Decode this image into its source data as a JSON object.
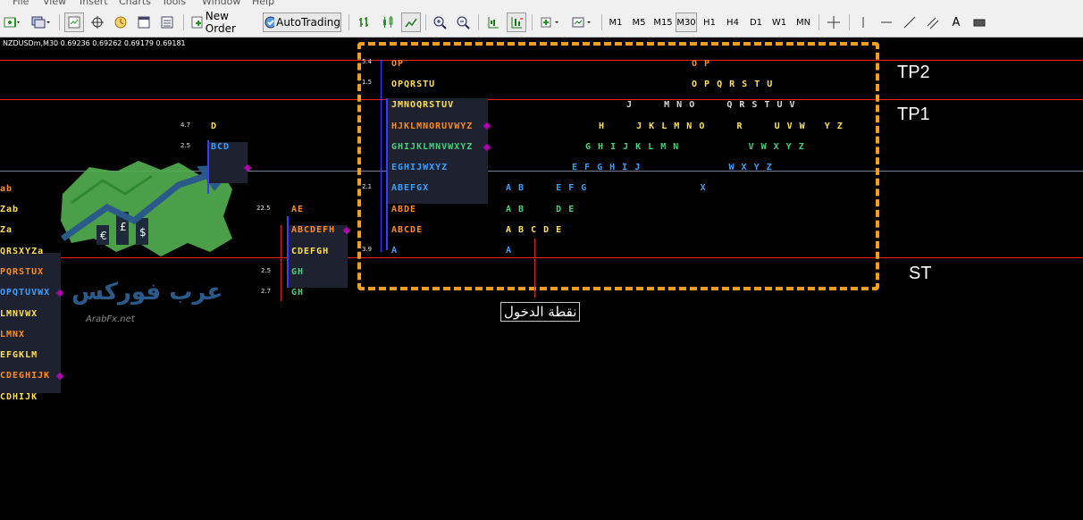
{
  "menu": [
    "File",
    "View",
    "Insert",
    "Charts",
    "Tools",
    "Window",
    "Help"
  ],
  "toolbar": {
    "new_order_label": "New Order",
    "autotrading_label": "AutoTrading",
    "timeframes": [
      "M1",
      "M5",
      "M15",
      "M30",
      "H1",
      "H4",
      "D1",
      "W1",
      "MN"
    ],
    "active_timeframe": "M30",
    "text_tool_label": "A"
  },
  "chart": {
    "symbol_info": "NZDUSDm,M30  0.69236 0.69262 0.69179 0.69181",
    "levels": {
      "tp2": "TP2",
      "tp1": "TP1",
      "st": "ST"
    },
    "entry_label": "نقطة الدخول",
    "logo_text": "عرب فوركس",
    "logo_sub": "ArabFx.net",
    "colors": {
      "level_line": "#ff2020",
      "price_line": "#7a7f9a",
      "box": "#f0a020",
      "profile_bar": "#3b3bff"
    },
    "profile_left": [
      "ab",
      "Zab",
      "Za",
      "QRSXYZa",
      "PQRSTUX",
      "OPQTUVWX",
      "LMNVWX",
      "LMNX",
      "EFGKLM",
      "CDEGHIJK",
      "CDHIJK"
    ],
    "profile_mid_top": {
      "d": "D",
      "bcd": "BCD",
      "val1": "4.7",
      "val2": "2.5"
    },
    "profile_mid": [
      "AE",
      "ABCDEFH",
      "CDEFGH",
      "GH",
      "GH"
    ],
    "profile_mid_vals": [
      "22.5",
      "2.5",
      "2.7"
    ],
    "profile_main": [
      "OP",
      "OPQRSTU",
      "JMNOQRSTUV",
      "HJKLMNORUVWYZ",
      "GHIJKLMNVWXYZ",
      "EGHIJWXYZ",
      "ABEFGX",
      "ABDE",
      "ABCDE",
      "A"
    ],
    "profile_main_vals": [
      "5.4",
      "1.5",
      "2.1",
      "3.9"
    ],
    "profile_right": [
      "O P",
      "O P Q R S T U",
      "J     M N O     Q R S T U V",
      "H     J K L M N O     R     U V W   Y Z",
      "G H I J K L M N           V W X Y Z",
      "E F G H I J              W X Y Z",
      "A B     E F G                  X",
      "A B     D E",
      "A B C D E",
      "A"
    ]
  }
}
